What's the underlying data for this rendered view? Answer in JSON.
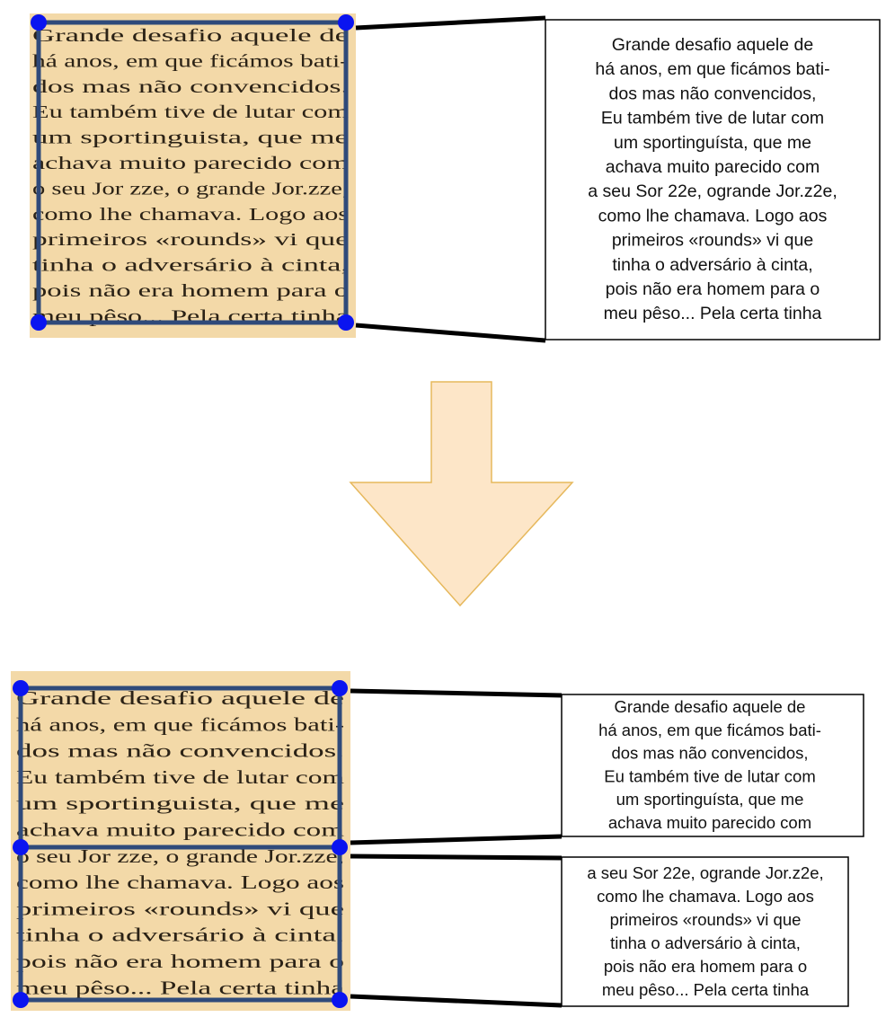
{
  "top": {
    "scan_lines": [
      "Grande desafio aquele de",
      "há anos, em que ficámos bati-",
      "dos mas não convencidos.",
      "Eu também tive de lutar com",
      "um sportinguista, que me",
      "achava muito parecido com",
      "o seu Jor zze, o grande Jor.zze,",
      "como lhe chamava. Logo aos",
      "primeiros «rounds» vi que",
      "tinha o adversário à cinta,",
      "pois não era homem para o",
      "meu pêso... Pela certa tinha"
    ],
    "ocr_lines": [
      "Grande desafio aquele de",
      "há anos, em que ficámos bati-",
      "dos mas não convencidos,",
      "Eu também tive de lutar com",
      "um sportinguísta, que me",
      "achava muito parecido com",
      "a seu Sor 22e, ogrande Jor.z2e,",
      "como lhe chamava. Logo aos",
      "primeiros «rounds» vi que",
      "tinha o adversário à cinta,",
      "pois não era homem para o",
      "meu pêso... Pela certa tinha"
    ]
  },
  "bottom": {
    "scan_lines": [
      "Grande desafio aquele de",
      "há anos, em que ficámos bati-",
      "dos mas não convencidos.",
      "Eu também tive de lutar com",
      "um sportinguista, que me",
      "achava muito parecido com",
      "o seu Jor zze, o grande Jor.zze,",
      "como lhe chamava. Logo aos",
      "primeiros «rounds» vi que",
      "tinha o adversário à cinta,",
      "pois não era homem para o",
      "meu pêso... Pela certa tinha"
    ],
    "ocr_block_1": [
      "Grande desafio aquele de",
      "há anos, em que ficámos bati-",
      "dos mas não convencidos,",
      "Eu também tive de lutar com",
      "um sportinguísta, que me",
      "achava muito parecido com"
    ],
    "ocr_block_2": [
      "a seu Sor 22e, ogrande Jor.z2e,",
      "como lhe chamava. Logo aos",
      "primeiros «rounds» vi que",
      "tinha o adversário à cinta,",
      "pois não era homem para o",
      "meu pêso... Pela certa tinha"
    ]
  },
  "colors": {
    "scan_background": "#f3d9a8",
    "selection_box": "#2f4a7a",
    "handle": "#0a14f0",
    "arrow_fill": "#fde6c8",
    "arrow_stroke": "#e6b85c",
    "connector": "#000000",
    "text_box_border": "#000000"
  }
}
